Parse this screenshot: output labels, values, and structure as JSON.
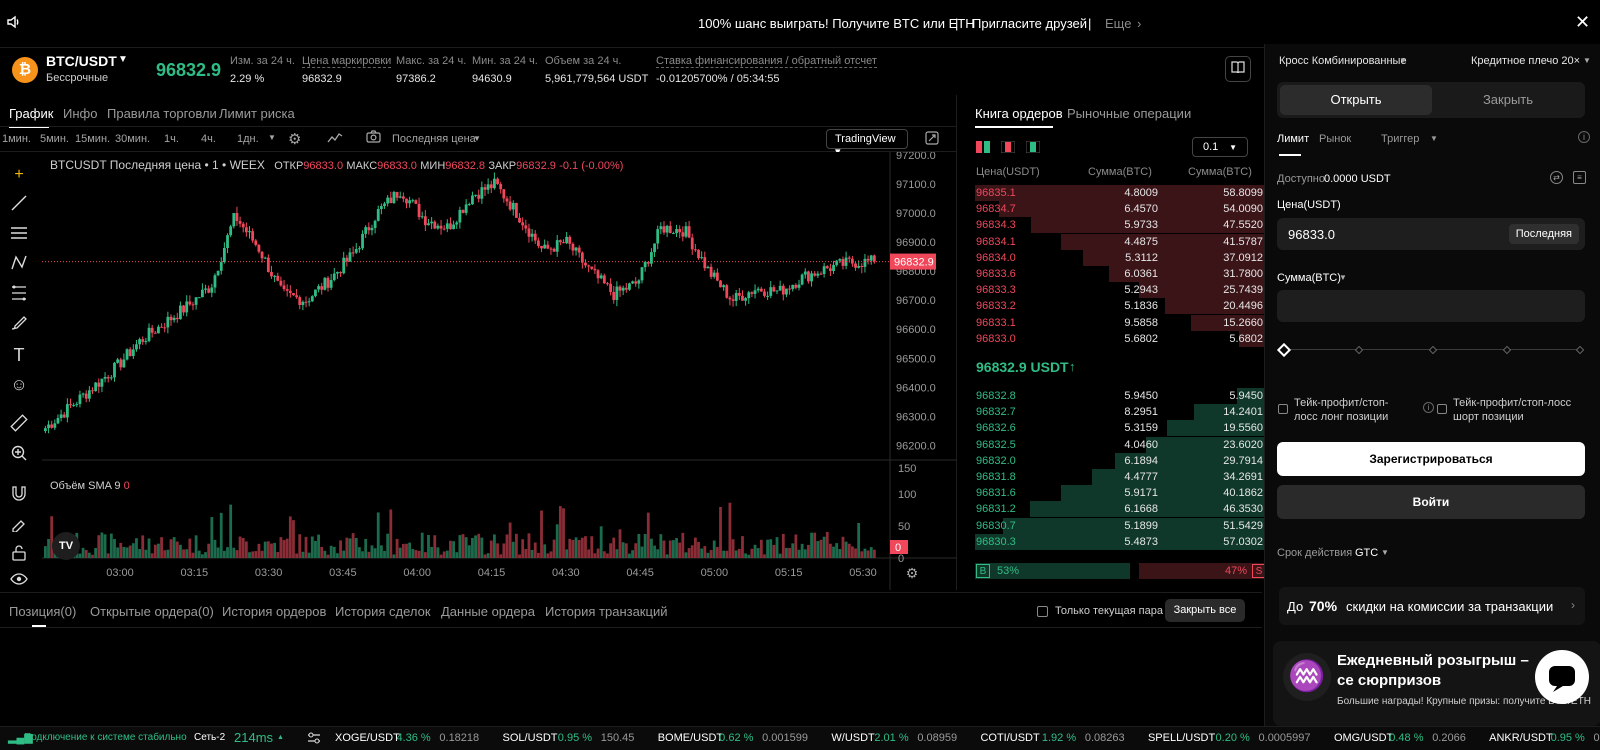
{
  "banner": {
    "promo": "100% шанс выиграть! Получите BTC или ETH",
    "sep1": "|",
    "invite": "Пригласите друзей",
    "sep2": "|",
    "more": "Еще"
  },
  "ticker": {
    "pair": "BTC/USDT",
    "type": "Бессрочные",
    "price": "96832.9",
    "stats": [
      {
        "label": "Изм. за 24 ч.",
        "value": "2.29 %"
      },
      {
        "label": "Цена маркировки",
        "value": "96832.9"
      },
      {
        "label": "Макс. за 24 ч.",
        "value": "97386.2"
      },
      {
        "label": "Мин. за 24 ч.",
        "value": "94630.9"
      },
      {
        "label": "Объем за 24 ч.",
        "value": "5,961,779,564 USDT"
      },
      {
        "label": "Ставка финансирования / обратный отсчет",
        "value": "-0.01205700% / 05:34:55"
      }
    ]
  },
  "chart_tabs": [
    "График",
    "Инфо",
    "Правила торговли",
    "Лимит риска"
  ],
  "intervals": [
    "1мин.",
    "5мин.",
    "15мин.",
    "30мин.",
    "1ч.",
    "4ч.",
    "1дн."
  ],
  "toolbar": {
    "price_type": "Последняя цена",
    "tradingview": "TradingView"
  },
  "chart_legend": {
    "symbol": "BTCUSDT Последняя цена • 1 • WEEX",
    "o_label": "ОТКР",
    "o": "96833.0",
    "h_label": "МАКС",
    "h": "96833.0",
    "l_label": "МИН",
    "l": "96832.8",
    "c_label": "ЗАКР",
    "c": "96832.9",
    "chg": "-0.1 (-0.00%)",
    "volume_label": "Объём SMA 9",
    "volume_val": "0"
  },
  "chart_data": {
    "type": "candlestick",
    "price_axis": [
      "97200.0",
      "97100.0",
      "97000.0",
      "96900.0",
      "96800.0",
      "96700.0",
      "96600.0",
      "96500.0",
      "96400.0",
      "96300.0",
      "96200.0"
    ],
    "ylim": [
      96150,
      97210
    ],
    "last_price": "96832.9",
    "time_axis": [
      "03:00",
      "03:15",
      "03:30",
      "03:45",
      "04:00",
      "04:15",
      "04:30",
      "04:45",
      "05:00",
      "05:15",
      "05:30"
    ],
    "volume_axis": [
      "150",
      "100",
      "50",
      "0"
    ],
    "volume_max": 150,
    "anchors": [
      96260,
      96330,
      96400,
      96470,
      96560,
      96620,
      96680,
      96750,
      96990,
      96880,
      96720,
      96700,
      96770,
      96860,
      97000,
      97080,
      96980,
      96950,
      97060,
      97100,
      96990,
      96870,
      96900,
      96800,
      96720,
      96760,
      96950,
      96940,
      96800,
      96700,
      96740,
      96730,
      96780,
      96810,
      96830,
      96833
    ]
  },
  "orderbook": {
    "tabs": [
      "Книга ордеров",
      "Рыночные операции"
    ],
    "precision": "0.1",
    "headers": [
      "Цена(USDT)",
      "Сумма(BTC)",
      "Сумма(BTC)"
    ],
    "asks": [
      {
        "p": "96835.1",
        "a": "4.8009",
        "t": "58.8099",
        "d": 1.0
      },
      {
        "p": "96834.7",
        "a": "6.4570",
        "t": "54.0090",
        "d": 0.918
      },
      {
        "p": "96834.3",
        "a": "5.9733",
        "t": "47.5520",
        "d": 0.809
      },
      {
        "p": "96834.1",
        "a": "4.4875",
        "t": "41.5787",
        "d": 0.707
      },
      {
        "p": "96834.0",
        "a": "5.3112",
        "t": "37.0912",
        "d": 0.631
      },
      {
        "p": "96833.6",
        "a": "6.0361",
        "t": "31.7800",
        "d": 0.54
      },
      {
        "p": "96833.3",
        "a": "5.2943",
        "t": "25.7439",
        "d": 0.438
      },
      {
        "p": "96833.2",
        "a": "5.1836",
        "t": "20.4496",
        "d": 0.348
      },
      {
        "p": "96833.1",
        "a": "9.5858",
        "t": "15.2660",
        "d": 0.26
      },
      {
        "p": "96833.0",
        "a": "5.6802",
        "t": "5.6802",
        "d": 0.097
      }
    ],
    "mid_price": "96832.9 USDT",
    "mid_arrow": "↑",
    "bids": [
      {
        "p": "96832.8",
        "a": "5.9450",
        "t": "5.9450",
        "d": 0.104
      },
      {
        "p": "96832.7",
        "a": "8.2951",
        "t": "14.2401",
        "d": 0.25
      },
      {
        "p": "96832.6",
        "a": "5.3159",
        "t": "19.5560",
        "d": 0.343
      },
      {
        "p": "96832.5",
        "a": "4.0460",
        "t": "23.6020",
        "d": 0.414
      },
      {
        "p": "96832.0",
        "a": "6.1894",
        "t": "29.7914",
        "d": 0.522
      },
      {
        "p": "96831.8",
        "a": "4.4777",
        "t": "34.2691",
        "d": 0.601
      },
      {
        "p": "96831.6",
        "a": "5.9171",
        "t": "40.1862",
        "d": 0.705
      },
      {
        "p": "96831.2",
        "a": "6.1668",
        "t": "46.3530",
        "d": 0.813
      },
      {
        "p": "96830.7",
        "a": "5.1899",
        "t": "51.5429",
        "d": 0.904
      },
      {
        "p": "96830.3",
        "a": "5.4873",
        "t": "57.0302",
        "d": 1.0
      }
    ],
    "buy_label": "B",
    "buy_pct": "53%",
    "buy_ratio": 0.53,
    "sell_label": "S",
    "sell_pct": "47%"
  },
  "bottom_tabs": [
    "Позиция(0)",
    "Открытые ордера(0)",
    "История ордеров",
    "История сделок",
    "Данные ордера",
    "История транзакций"
  ],
  "bottom_controls": {
    "only_pair": "Только текущая пара",
    "close_all": "Закрыть все"
  },
  "trade": {
    "margin_mode": "Кросс Комбинированные",
    "leverage": "Кредитное плечо 20×",
    "open": "Открыть",
    "close": "Закрыть",
    "order_types": [
      "Лимит",
      "Рынок",
      "Триггер"
    ],
    "available_label": "Доступно",
    "available_value": "0.0000 USDT",
    "price_label": "Цена(USDT)",
    "price_value": "96833.0",
    "last_btn": "Последняя",
    "amount_label": "Сумма(BTC)",
    "tpsl_long": "Тейк-профит/стоп-лосс лонг позиции",
    "tpsl_short": "Тейк-профит/стоп-лосс шорт позиции",
    "register": "Зарегистрироваться",
    "login": "Войти",
    "tif_label": "Срок действия",
    "tif_value": "GTC",
    "promo_prefix": "До",
    "promo_bold": "70%",
    "promo_suffix": "скидки на комиссии за транзакции",
    "draw_title": "Ежедневный розыгрыш – се сюрпризов",
    "draw_sub": "Большие награды! Крупные призы: получите BTC/ETH"
  },
  "statusbar": {
    "conn": "Подключение к системе стабильно",
    "net_label": "Сеть-2",
    "latency": "214ms",
    "markets": [
      {
        "pair": "XOGE/USDT",
        "chg": "4.36 %",
        "price": "0.18218"
      },
      {
        "pair": "SOL/USDT",
        "chg": "0.95 %",
        "price": "150.45"
      },
      {
        "pair": "BOME/USDT",
        "chg": "0.62 %",
        "price": "0.001599"
      },
      {
        "pair": "W/USDT",
        "chg": "2.01 %",
        "price": "0.08959"
      },
      {
        "pair": "COTI/USDT",
        "chg": "1.92 %",
        "price": "0.08263"
      },
      {
        "pair": "SPELL/USDT",
        "chg": "0.20 %",
        "price": "0.0005997"
      },
      {
        "pair": "OMG/USDT",
        "chg": "0.48 %",
        "price": "0.2066"
      },
      {
        "pair": "ANKR/USDT",
        "chg": "0.95 %",
        "price": "0.02"
      }
    ]
  },
  "colors": {
    "up": "#2fbd85",
    "down": "#f0475b",
    "bg": "#000000",
    "panel": "#0a0a0a"
  }
}
